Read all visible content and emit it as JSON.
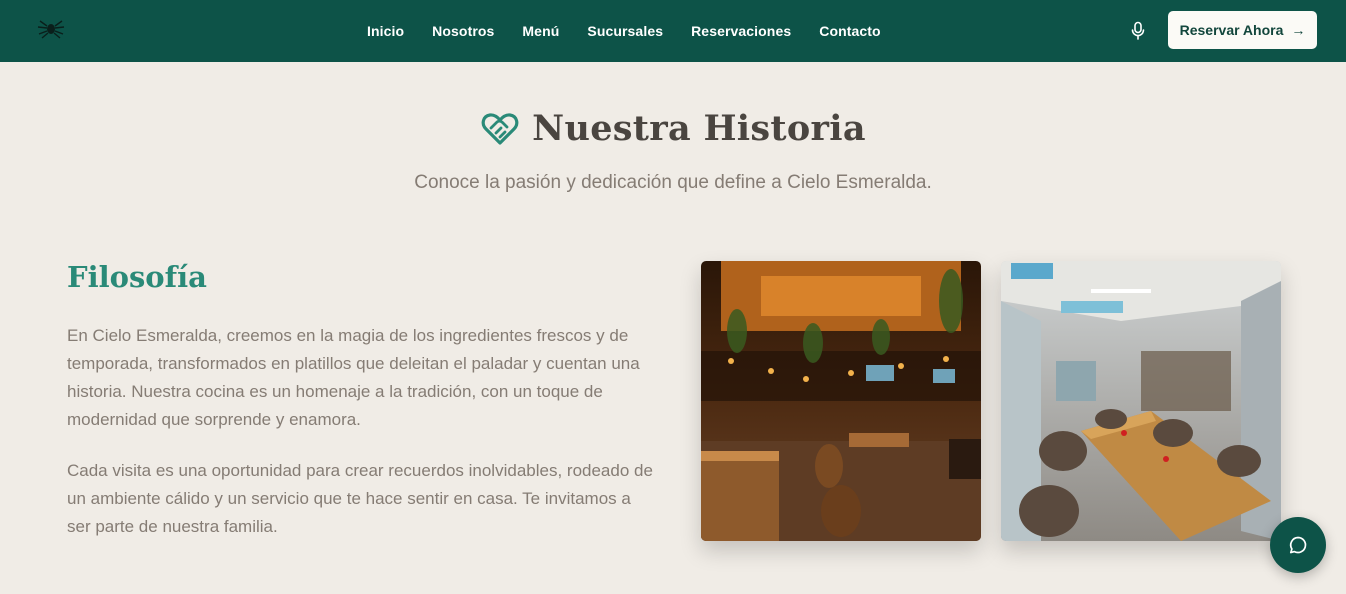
{
  "header": {
    "logo_icon": "spider-logo-icon",
    "nav": [
      {
        "label": "Inicio"
      },
      {
        "label": "Nosotros"
      },
      {
        "label": "Menú"
      },
      {
        "label": "Sucursales"
      },
      {
        "label": "Reservaciones"
      },
      {
        "label": "Contacto"
      }
    ],
    "mic_icon": "microphone-icon",
    "cta_label": "Reservar Ahora",
    "cta_arrow": "→",
    "bg_color": "#0d5348"
  },
  "story": {
    "title": "Nuestra Historia",
    "title_icon": "heart-handshake-icon",
    "subtitle": "Conoce la pasión y dedicación que define a Cielo Esmeralda."
  },
  "philosophy": {
    "title": "Filosofía",
    "paragraph1": "En Cielo Esmeralda, creemos en la magia de los ingredientes frescos y de temporada, transformados en platillos que deleitan el paladar y cuentan una historia. Nuestra cocina es un homenaje a la tradición, con un toque de modernidad que sorprende y enamora.",
    "paragraph2": "Cada visita es una oportunidad para crear recuerdos inolvidables, rodeado de un ambiente cálido y un servicio que te hace sentir en casa. Te invitamos a ser parte de nuestra familia."
  },
  "gallery": [
    {
      "name": "interior-bar-photo"
    },
    {
      "name": "terrace-dining-photo"
    }
  ],
  "chat": {
    "icon": "chat-bubble-icon"
  },
  "colors": {
    "accent": "#2a8a78",
    "page_bg": "#f0ece6",
    "text_muted": "#857c74"
  }
}
